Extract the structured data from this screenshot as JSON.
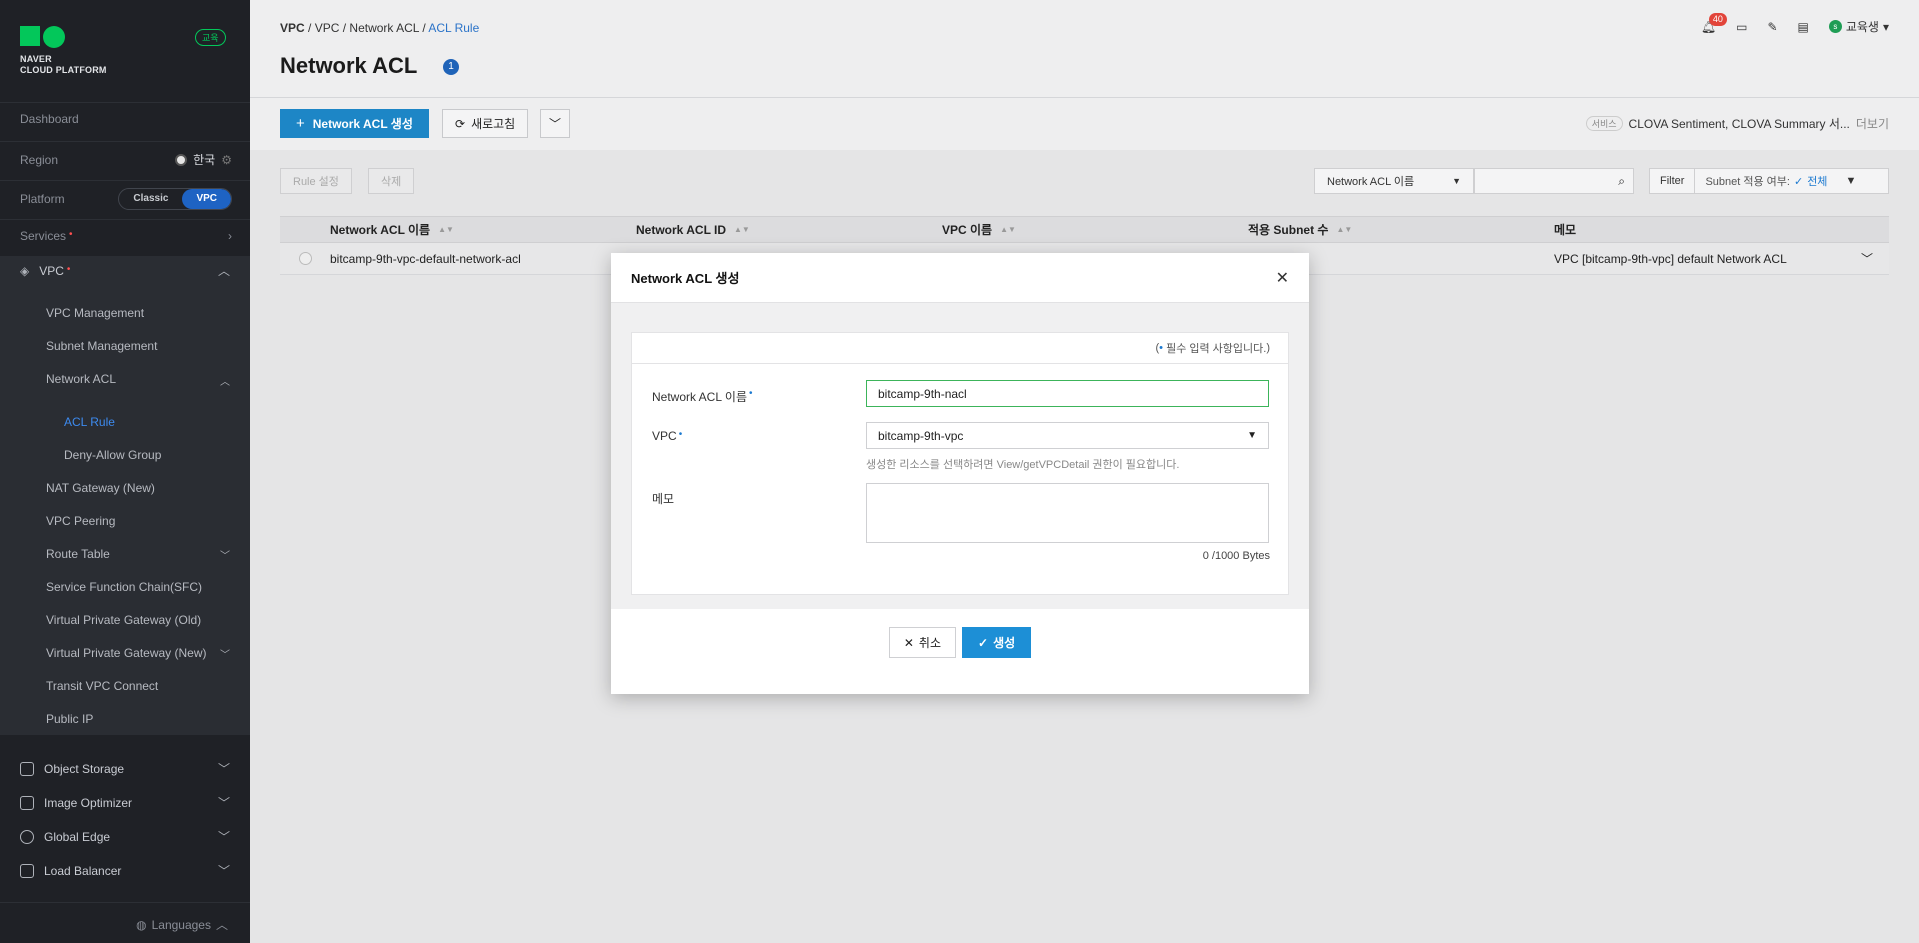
{
  "sidebar": {
    "logo_line1": "NAVER",
    "logo_line2": "CLOUD PLATFORM",
    "env_badge": "교육",
    "dashboard": "Dashboard",
    "region_label": "Region",
    "region_value": "한국",
    "platform_label": "Platform",
    "platform_classic": "Classic",
    "platform_vpc": "VPC",
    "services": "Services",
    "vpc": "VPC",
    "vpc_items": [
      "VPC Management",
      "Subnet Management",
      "Network ACL"
    ],
    "acl_items": [
      "ACL Rule",
      "Deny-Allow Group"
    ],
    "vpc_items2": [
      "NAT Gateway (New)",
      "VPC Peering",
      "Route Table",
      "Service Function Chain(SFC)",
      "Virtual Private Gateway (Old)",
      "Virtual Private Gateway (New)",
      "Transit VPC Connect",
      "Public IP"
    ],
    "bottom_items": [
      "Object Storage",
      "Image Optimizer",
      "Global Edge",
      "Load Balancer"
    ],
    "languages": "Languages"
  },
  "breadcrumb": {
    "items": [
      "VPC",
      "VPC",
      "Network ACL"
    ],
    "current": "ACL Rule"
  },
  "header": {
    "title": "Network ACL",
    "count": "1",
    "notif_count": "40",
    "user": "교육생",
    "user_initial": "s"
  },
  "toolbar": {
    "create_label": "Network ACL 생성",
    "refresh_label": "새로고침",
    "svc_tag": "서비스",
    "svc_text": "CLOVA Sentiment, CLOVA Summary 서...",
    "svc_more": "더보기"
  },
  "filters": {
    "rule_btn": "Rule 설정",
    "delete_btn": "삭제",
    "select_value": "Network ACL 이름",
    "filter_label": "Filter",
    "subnet_label": "Subnet 적용 여부:",
    "subnet_value": "전체"
  },
  "table": {
    "headers": [
      "Network ACL 이름",
      "Network ACL ID",
      "VPC 이름",
      "적용 Subnet 수",
      "메모"
    ],
    "row": {
      "name": "bitcamp-9th-vpc-default-network-acl",
      "memo": "VPC [bitcamp-9th-vpc] default Network ACL"
    }
  },
  "modal": {
    "title": "Network ACL 생성",
    "required_note": "필수 입력 사항입니다.",
    "name_label": "Network ACL 이름",
    "name_value": "bitcamp-9th-nacl",
    "vpc_label": "VPC",
    "vpc_value": "bitcamp-9th-vpc",
    "vpc_hint": "생성한 리소스를 선택하려면 View/getVPCDetail 권한이 필요합니다.",
    "memo_label": "메모",
    "memo_count": "0 /1000 Bytes",
    "cancel_label": "취소",
    "create_label": "생성"
  },
  "colors": {
    "primary": "#1d86c6",
    "link": "#2b73c8",
    "brand": "#03c75a",
    "sidebar_bg": "#1f2126"
  }
}
